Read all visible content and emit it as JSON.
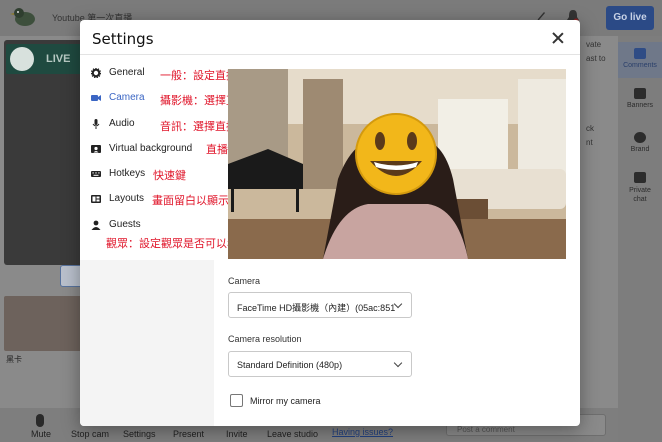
{
  "studio": {
    "title": "Youtube 第一次直播",
    "go_live": "Go live",
    "live_chip": "LIVE",
    "guest_name": "黑卡",
    "right_text": [
      "vate",
      "ast to",
      "ck",
      "nt"
    ]
  },
  "rail": [
    {
      "label": "Comments",
      "icon": "comments-icon",
      "active": true
    },
    {
      "label": "Banners",
      "icon": "banners-icon",
      "active": false
    },
    {
      "label": "Brand",
      "icon": "brand-icon",
      "active": false
    },
    {
      "label": "Private chat",
      "icon": "private-chat-icon",
      "active": false
    }
  ],
  "bottom_bar": {
    "mute": "Mute",
    "stop_cam": "Stop cam",
    "settings": "Settings",
    "present": "Present",
    "invite": "Invite",
    "leave": "Leave studio",
    "issues": "Having issues?",
    "comment_placeholder": "Post a comment"
  },
  "modal": {
    "title": "Settings",
    "nav": [
      {
        "label": "General",
        "icon": "gear-icon"
      },
      {
        "label": "Camera",
        "icon": "camera-icon",
        "active": true
      },
      {
        "label": "Audio",
        "icon": "microphone-icon"
      },
      {
        "label": "Virtual background",
        "icon": "background-icon"
      },
      {
        "label": "Hotkeys",
        "icon": "keyboard-icon"
      },
      {
        "label": "Layouts",
        "icon": "layout-icon"
      },
      {
        "label": "Guests",
        "icon": "person-icon"
      }
    ],
    "annotations": [
      "一般：設定直播畫質",
      "攝影機：選擇直播鏡頭",
      "音訊：選擇直播麥克風",
      "直播背景",
      "快速鍵",
      "畫面留白以顯示後方背景框",
      "觀眾：設定觀眾是否可以看到留言&設定黑名單"
    ],
    "camera_label": "Camera",
    "camera_value": "FaceTime HD攝影機（內建）(05ac:851",
    "resolution_label": "Camera resolution",
    "resolution_value": "Standard Definition (480p)",
    "mirror_label": "Mirror my camera",
    "mirror_checked": false
  },
  "colors": {
    "accent": "#3b66c4",
    "annotation": "#e0152a",
    "go_live": "#2b4a86"
  }
}
